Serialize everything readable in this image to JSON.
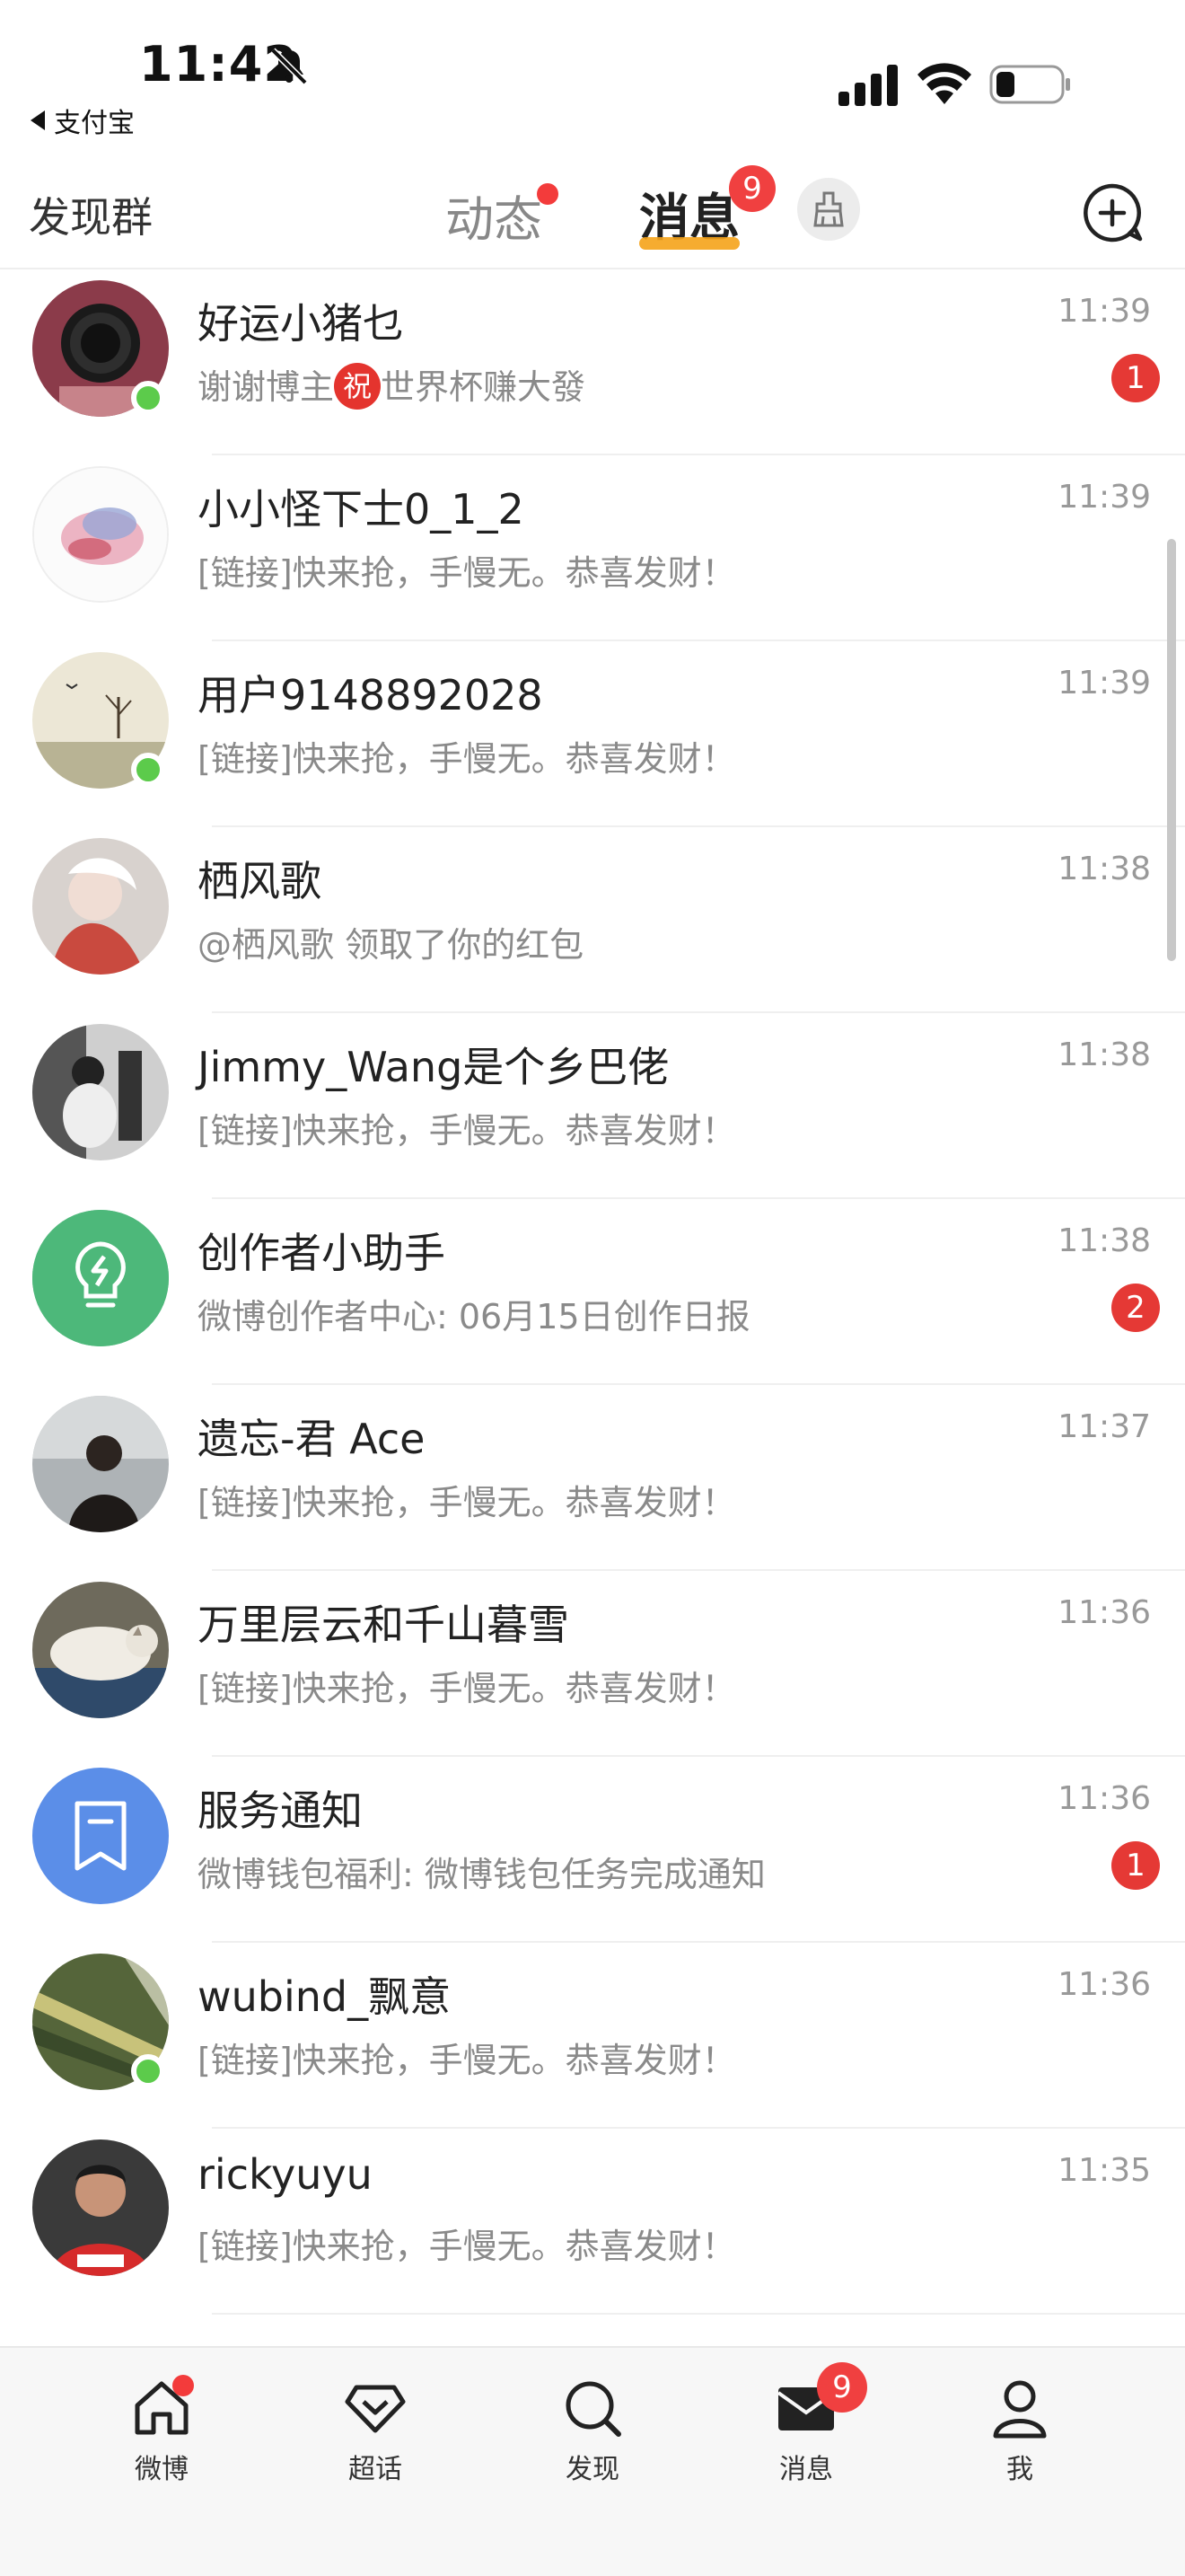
{
  "status_bar": {
    "time": "11:42",
    "back_app": "支付宝"
  },
  "header": {
    "left_link": "发现群",
    "tabs": [
      {
        "label": "动态",
        "has_dot": true
      },
      {
        "label": "消息",
        "badge": "9",
        "active": true
      }
    ]
  },
  "messages": [
    {
      "name": "好运小猪乜",
      "preview_before": "谢谢博主",
      "preview_tag": "祝",
      "preview": "世界杯赚大發",
      "time": "11:39",
      "unread": "1",
      "online": true
    },
    {
      "name": "小小怪下士0_1_2",
      "preview": "[链接]快来抢，手慢无。恭喜发财！",
      "time": "11:39",
      "unread": "",
      "online": false
    },
    {
      "name": "用户9148892028",
      "preview": "[链接]快来抢，手慢无。恭喜发财！",
      "time": "11:39",
      "unread": "",
      "online": true
    },
    {
      "name": "栖风歌",
      "preview": "@栖风歌 领取了你的红包",
      "time": "11:38",
      "unread": "",
      "online": false
    },
    {
      "name": "Jimmy_Wang是个乡巴佬",
      "preview": "[链接]快来抢，手慢无。恭喜发财！",
      "time": "11:38",
      "unread": "",
      "online": false
    },
    {
      "name": "创作者小助手",
      "preview": "微博创作者中心: 06月15日创作日报",
      "time": "11:38",
      "unread": "2",
      "online": false
    },
    {
      "name": "遗忘-君 Ace",
      "preview": "[链接]快来抢，手慢无。恭喜发财！",
      "time": "11:37",
      "unread": "",
      "online": false
    },
    {
      "name": "万里层云和千山暮雪",
      "preview": "[链接]快来抢，手慢无。恭喜发财！",
      "time": "11:36",
      "unread": "",
      "online": false
    },
    {
      "name": "服务通知",
      "preview": "微博钱包福利: 微博钱包任务完成通知",
      "time": "11:36",
      "unread": "1",
      "online": false
    },
    {
      "name": "wubind_飘意",
      "preview": "[链接]快来抢，手慢无。恭喜发财！",
      "time": "11:36",
      "unread": "",
      "online": true
    },
    {
      "name": "rickyuyu",
      "preview": "[链接]快来抢，手慢无。恭喜发财！",
      "time": "11:35",
      "unread": "",
      "online": false
    }
  ],
  "tab_bar": {
    "items": [
      {
        "label": "微博",
        "icon": "home-icon",
        "dot": true
      },
      {
        "label": "超话",
        "icon": "diamond-icon"
      },
      {
        "label": "发现",
        "icon": "search-icon"
      },
      {
        "label": "消息",
        "icon": "mail-icon",
        "badge": "9"
      },
      {
        "label": "我",
        "icon": "person-icon"
      }
    ]
  },
  "colors": {
    "badge_red": "#e53935",
    "online_green": "#5ccb4b",
    "active_underline": "#f5a31a"
  }
}
